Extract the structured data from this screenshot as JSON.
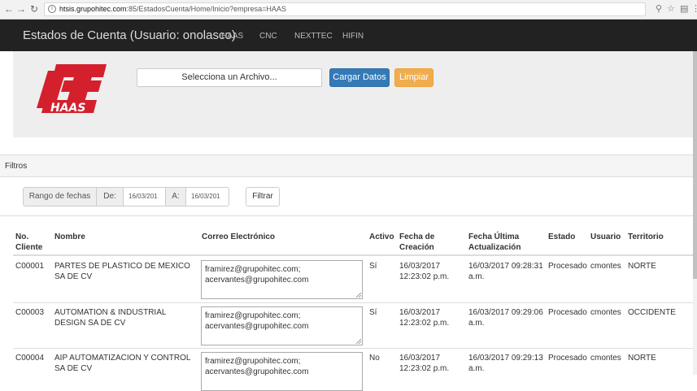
{
  "browser": {
    "url_host": "htsis.grupohitec.com",
    "url_path": ":85/EstadosCuenta/Home/Inicio?empresa=HAAS"
  },
  "navbar": {
    "brand": "Estados de Cuenta (Usuario: onolasco)",
    "items": [
      "HAAS",
      "CNC",
      "NEXTTEC",
      "HIFIN"
    ]
  },
  "header": {
    "logo_text": "HAAS",
    "file_placeholder": "Selecciona un Archivo...",
    "upload_label": "Cargar Datos",
    "clear_label": "Limpiar"
  },
  "filters": {
    "title": "Filtros",
    "range_label": "Rango de fechas",
    "from_label": "De:",
    "from_value": "16/03/201",
    "to_label": "A:",
    "to_value": "16/03/201",
    "filter_button": "Filtrar"
  },
  "table": {
    "headers": {
      "client_no_1": "No.",
      "client_no_2": "Cliente",
      "name": "Nombre",
      "email": "Correo Electrónico",
      "active": "Activo",
      "created_1": "Fecha de",
      "created_2": "Creación",
      "updated_1": "Fecha Última",
      "updated_2": "Actualización",
      "status": "Estado",
      "user": "Usuario",
      "territory": "Territorio"
    },
    "rows": [
      {
        "client": "C00001",
        "name_1": "PARTES DE PLASTICO DE MEXICO",
        "name_2": "SA DE CV",
        "email_1": "framirez@grupohitec.com;",
        "email_2": "acervantes@grupohitec.com",
        "active": "Sí",
        "created_1": "16/03/2017",
        "created_2": "12:23:02 p.m.",
        "updated_1": "16/03/2017 09:28:31",
        "updated_2": "a.m.",
        "status": "Procesado",
        "user": "cmontes",
        "territory": "NORTE"
      },
      {
        "client": "C00003",
        "name_1": "AUTOMATION & INDUSTRIAL",
        "name_2": "DESIGN SA DE CV",
        "email_1": "framirez@grupohitec.com;",
        "email_2": "acervantes@grupohitec.com",
        "active": "Sí",
        "created_1": "16/03/2017",
        "created_2": "12:23:02 p.m.",
        "updated_1": "16/03/2017 09:29:06",
        "updated_2": "a.m.",
        "status": "Procesado",
        "user": "cmontes",
        "territory": "OCCIDENTE"
      },
      {
        "client": "C00004",
        "name_1": "AIP AUTOMATIZACION Y CONTROL",
        "name_2": "SA DE CV",
        "email_1": "framirez@grupohitec.com;",
        "email_2": "acervantes@grupohitec.com",
        "active": "No",
        "created_1": "16/03/2017",
        "created_2": "12:23:02 p.m.",
        "updated_1": "16/03/2017 09:29:13",
        "updated_2": "a.m.",
        "status": "Procesado",
        "user": "cmontes",
        "territory": "NORTE"
      }
    ]
  },
  "colors": {
    "navbar": "#222222",
    "primary": "#337ab7",
    "warning": "#f0ad4e",
    "haas_red": "#d4202c"
  }
}
